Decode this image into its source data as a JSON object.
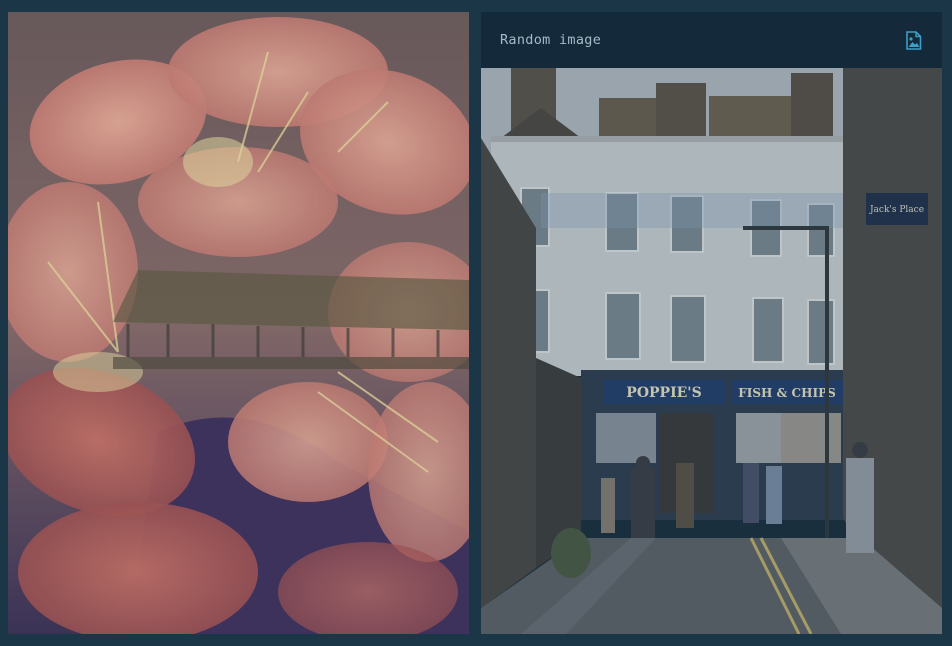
{
  "right_panel": {
    "title": "Random image",
    "icon": "image-icon"
  },
  "left_panel": {
    "image": "flowers-pier-blend"
  },
  "street_image": {
    "signs": {
      "shop_left": "POPPIE'S",
      "shop_right": "FISH & CHIPS",
      "hanging_sign": "Jack's Place"
    }
  }
}
